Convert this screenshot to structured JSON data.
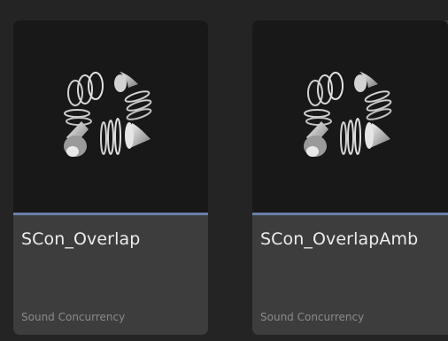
{
  "colors": {
    "background": "#242424",
    "tile_body": "#3d3d3d",
    "thumbnail_bg": "#181818",
    "asset_type_bar": "#6a7fa8",
    "name_text": "#ececec",
    "type_text": "#8a8a8a"
  },
  "assets": [
    {
      "name": "SCon_Overlap",
      "type": "Sound Concurrency",
      "icon": "sound-concurrency-icon"
    },
    {
      "name": "SCon_OverlapAmb",
      "type": "Sound Concurrency",
      "icon": "sound-concurrency-icon"
    }
  ]
}
